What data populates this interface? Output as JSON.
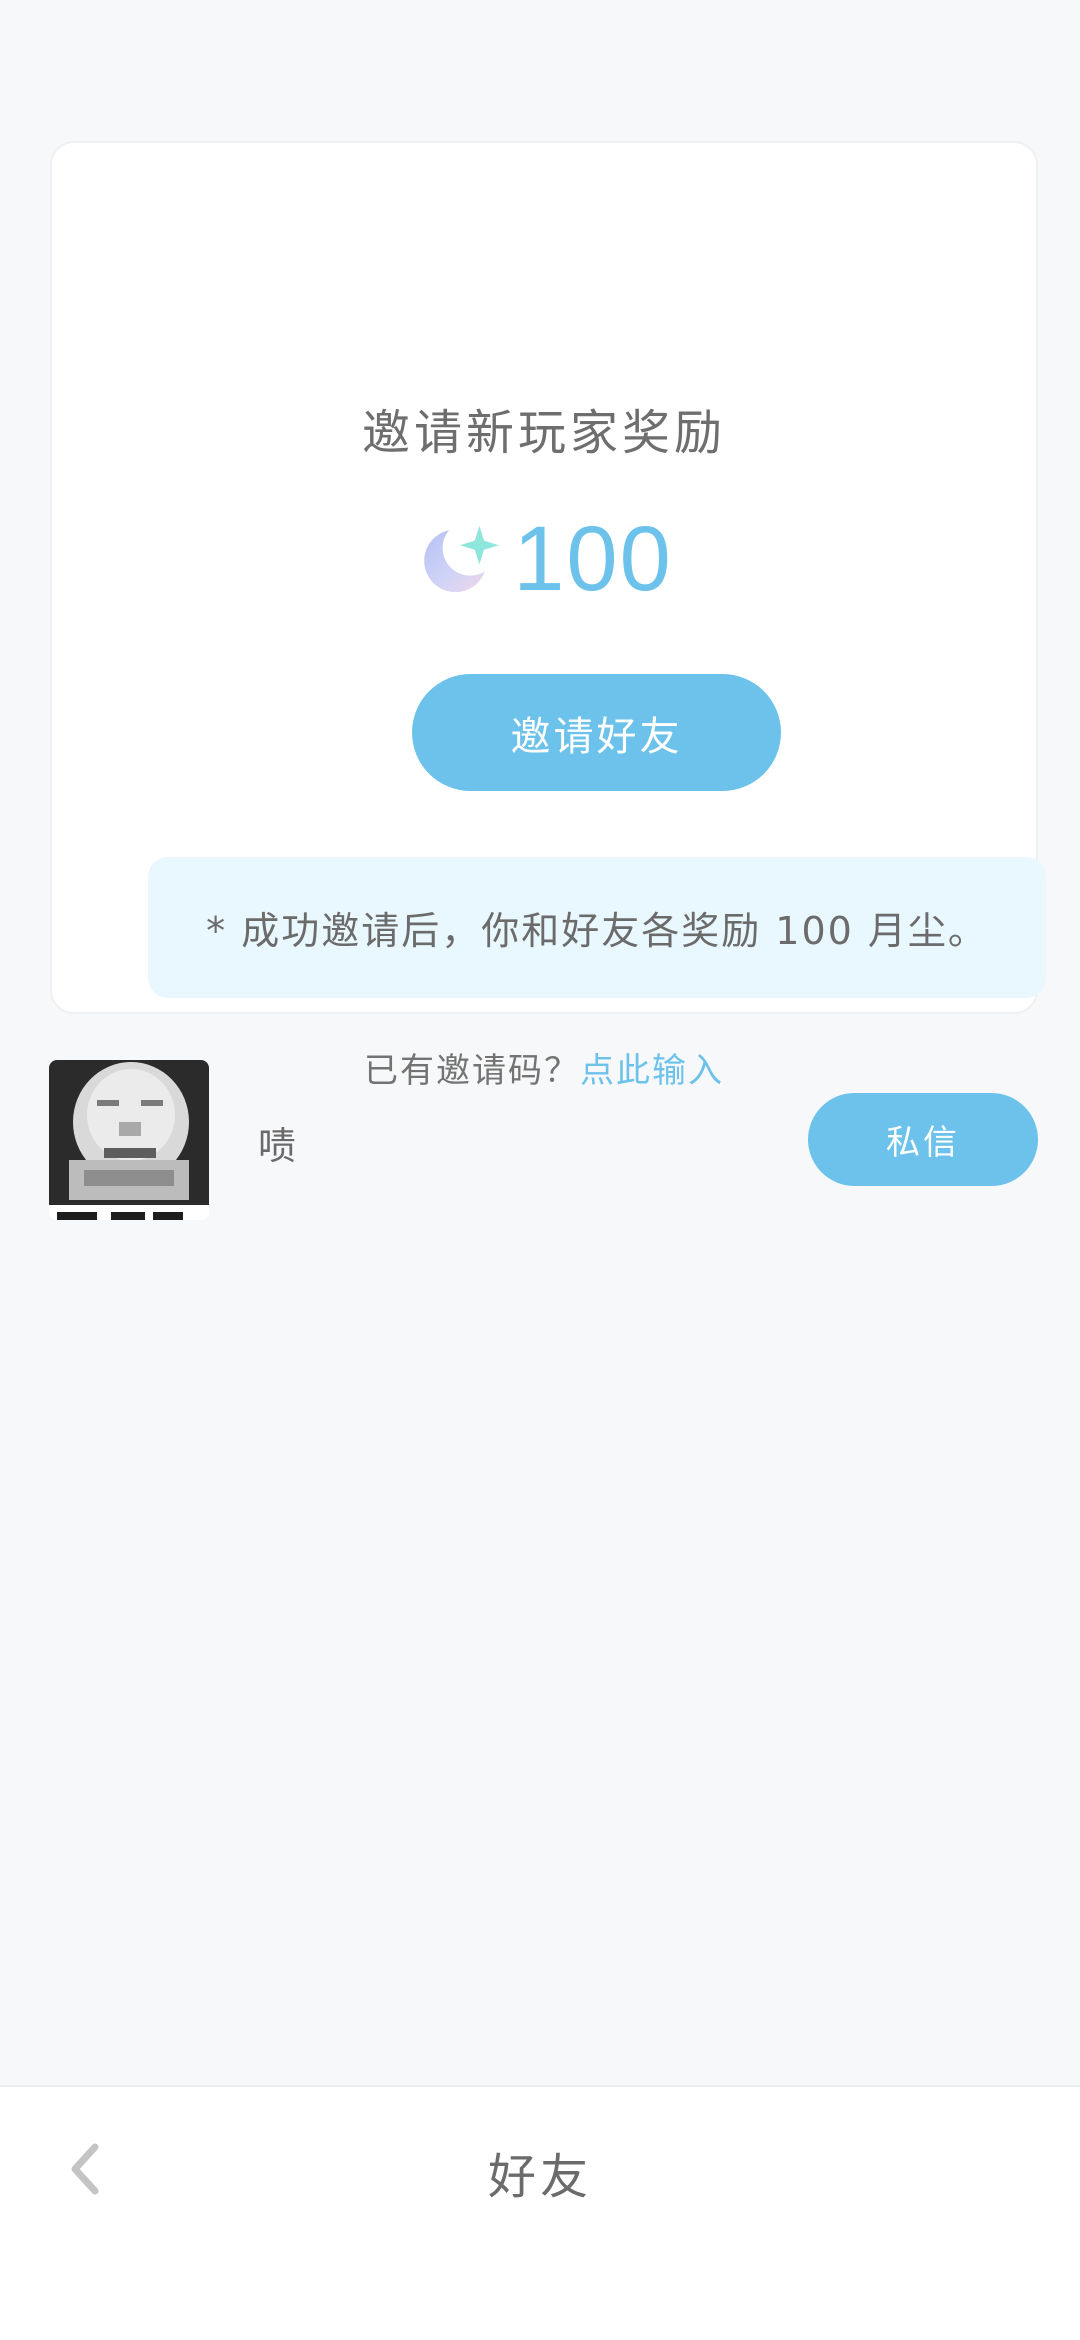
{
  "invite": {
    "title": "邀请新玩家奖励",
    "reward_amount": "100",
    "reward_icon": "moon-dust-icon",
    "invite_button_label": "邀请好友",
    "notice": "* 成功邀请后，你和好友各奖励 100 月尘。",
    "code_prompt": "已有邀请码？",
    "code_link": "点此输入"
  },
  "friends": [
    {
      "name": "啧",
      "avatar": "meme-avatar",
      "message_button_label": "私信"
    }
  ],
  "bottom_bar": {
    "title": "好友",
    "back_icon": "chevron-left-icon"
  },
  "colors": {
    "accent": "#6cc2ea",
    "notice_bg": "#e9f7fe",
    "page_bg": "#f7f8f9"
  }
}
